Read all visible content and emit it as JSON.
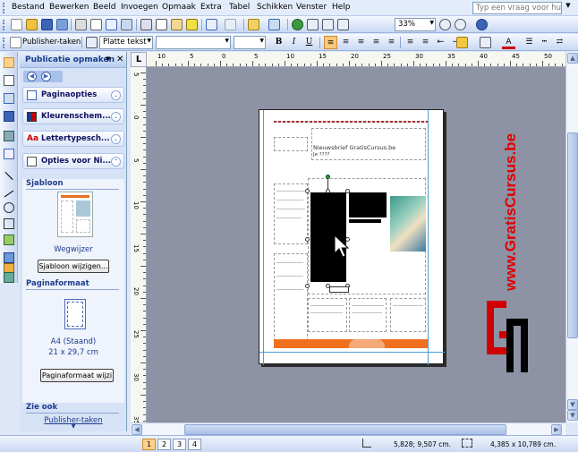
{
  "menu": [
    "Bestand",
    "Bewerken",
    "Beeld",
    "Invoegen",
    "Opmaak",
    "Extra",
    "Tabel",
    "Schikken",
    "Venster",
    "Help"
  ],
  "help_box": {
    "placeholder": "Typ een vraag voor hulp"
  },
  "toolbar": {
    "zoom": "33%",
    "style_label": "Publisher-taken",
    "font_style": "Platte tekst",
    "bold": "B",
    "italic": "I",
    "underline": "U",
    "font_color_letter": "A"
  },
  "task_pane": {
    "title": "Publicatie opmaken",
    "sections": [
      "Paginaopties",
      "Kleurenschem...",
      "Lettertypesch...",
      "Opties voor Ni..."
    ],
    "template_heading": "Sjabloon",
    "template_name": "Wegwijzer",
    "template_button": "Sjabloon wijzigen...",
    "page_size_heading": "Paginaformaat",
    "page_size_name": "A4 (Staand)",
    "page_size_dims": "21 x 29,7 cm",
    "page_size_button": "Paginaformaat wijzi",
    "see_also_heading": "Zie ook",
    "see_also_link": "Publisher-taken"
  },
  "rulers": {
    "corner": "L",
    "h_labels": [
      "10",
      "5",
      "0",
      "5",
      "10",
      "15",
      "20",
      "25",
      "30",
      "35",
      "40",
      "45",
      "50"
    ],
    "v_labels": [
      "5",
      "0",
      "5",
      "10",
      "15",
      "20",
      "25",
      "30",
      "35"
    ]
  },
  "newsletter": {
    "title": "Nieuwsbrief GratisCursus.be",
    "subtitle": "Je ????"
  },
  "status": {
    "pages": [
      "1",
      "2",
      "3",
      "4"
    ],
    "position": "5,828; 9,507 cm.",
    "size": "4,385 x 10,789 cm."
  },
  "watermark": {
    "text": "www.GratisCursus.be",
    "color": "#e00000"
  },
  "colors": {
    "accent": "#e8e8f0",
    "page_banner": "#f07020"
  }
}
